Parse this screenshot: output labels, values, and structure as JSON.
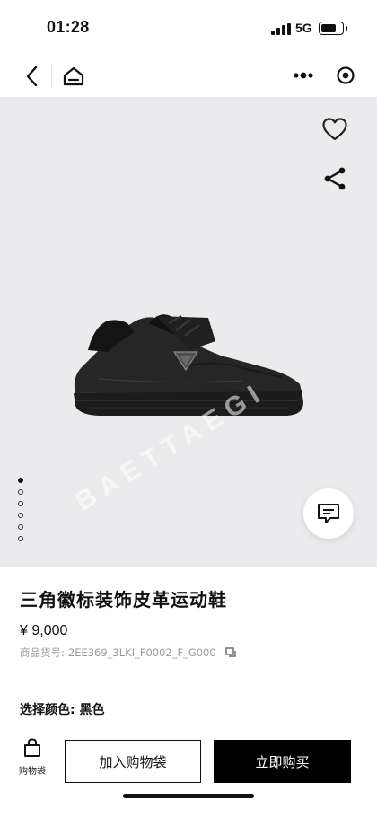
{
  "status_bar": {
    "time": "01:28",
    "network": "5G",
    "battery_level": 0.75
  },
  "nav": {
    "back_icon": "chevron-left-icon",
    "home_icon": "home-icon",
    "more_icon": "more-dots-icon",
    "target_icon": "target-icon"
  },
  "gallery": {
    "watermark": "BAETTAEGI",
    "image_count": 6,
    "active_index": 0,
    "favorite_icon": "heart-icon",
    "share_icon": "share-icon",
    "chat_icon": "chat-icon"
  },
  "product": {
    "title": "三角徽标装饰皮革运动鞋",
    "price": "¥ 9,000",
    "sku_label": "商品货号:",
    "sku": "2EE369_3LKI_F0002_F_G000",
    "color_label": "选择颜色:",
    "color_value": "黑色"
  },
  "bottom_bar": {
    "bag_label": "购物袋",
    "add_to_bag": "加入购物袋",
    "buy_now": "立即购买"
  }
}
